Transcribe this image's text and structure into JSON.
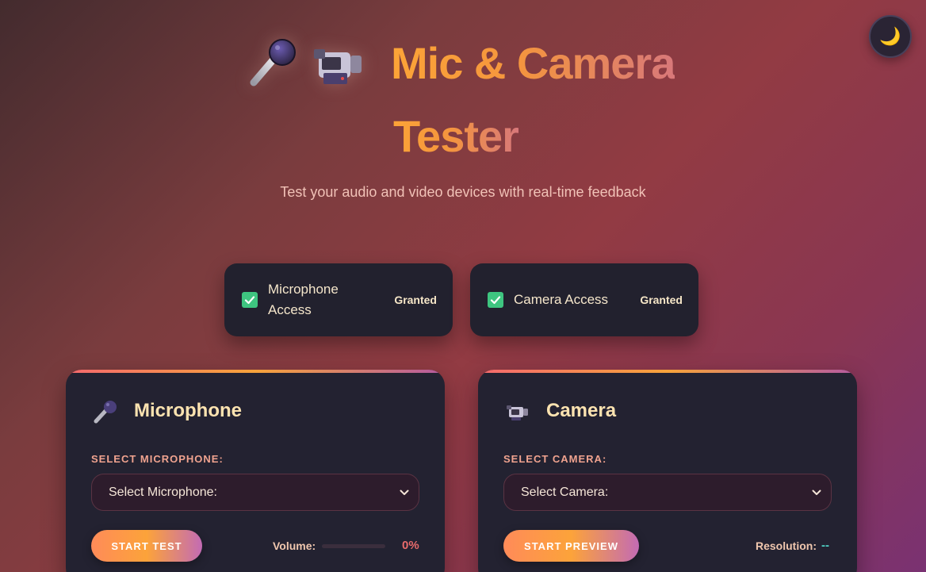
{
  "header": {
    "title_line1": "Mic & Camera",
    "title_line2": "Tester",
    "subtitle": "Test your audio and video devices with real-time feedback",
    "hero_icons": [
      "microphone-icon",
      "video-camera-icon"
    ]
  },
  "theme_toggle": {
    "icon": "moon-icon",
    "glyph": "🌙"
  },
  "permissions": [
    {
      "label": "Microphone Access",
      "status": "Granted",
      "checked": true
    },
    {
      "label": "Camera Access",
      "status": "Granted",
      "checked": true
    }
  ],
  "microphone": {
    "title": "Microphone",
    "icon": "microphone-icon",
    "select_label": "SELECT MICROPHONE:",
    "select_value": "Select Microphone:",
    "button_label": "START TEST",
    "volume_label": "Volume:",
    "volume_value": "0%",
    "volume_level": 0
  },
  "camera": {
    "title": "Camera",
    "icon": "video-camera-icon",
    "select_label": "SELECT CAMERA:",
    "select_value": "Select Camera:",
    "button_label": "START PREVIEW",
    "resolution_label": "Resolution:",
    "resolution_value": "--"
  },
  "colors": {
    "accent_orange": "#fca437",
    "accent_pink": "#d8787a",
    "granted_green": "#3ec580",
    "volume_red": "#e86b6b",
    "resolution_teal": "#4fd0c4"
  }
}
